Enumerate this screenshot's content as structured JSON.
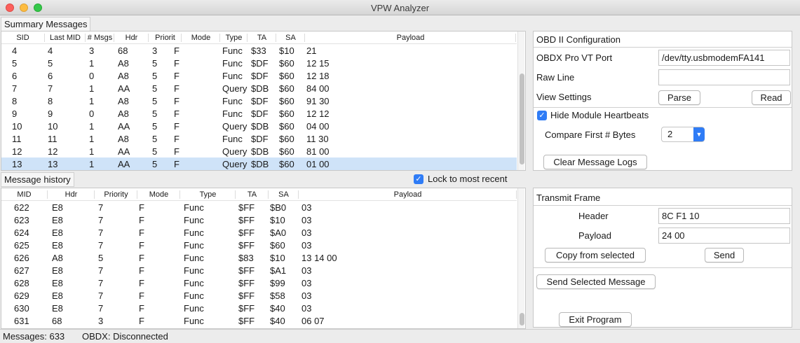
{
  "window": {
    "title": "VPW Analyzer"
  },
  "summary": {
    "tab_label": "Summary Messages",
    "columns": [
      "SID",
      "Last MID",
      "# Msgs",
      "Hdr",
      "Priorit",
      "Mode",
      "Type",
      "TA",
      "SA",
      "Payload"
    ],
    "rows": [
      [
        "4",
        "4",
        "3",
        "68",
        "3",
        "F",
        "Func",
        "$33",
        "$10",
        "21"
      ],
      [
        "5",
        "5",
        "1",
        "A8",
        "5",
        "F",
        "Func",
        "$DF",
        "$60",
        "12 15"
      ],
      [
        "6",
        "6",
        "0",
        "A8",
        "5",
        "F",
        "Func",
        "$DF",
        "$60",
        "12 18"
      ],
      [
        "7",
        "7",
        "1",
        "AA",
        "5",
        "F",
        "Query",
        "$DB",
        "$60",
        "84 00"
      ],
      [
        "8",
        "8",
        "1",
        "A8",
        "5",
        "F",
        "Func",
        "$DF",
        "$60",
        "91 30"
      ],
      [
        "9",
        "9",
        "0",
        "A8",
        "5",
        "F",
        "Func",
        "$DF",
        "$60",
        "12 12"
      ],
      [
        "10",
        "10",
        "1",
        "AA",
        "5",
        "F",
        "Query",
        "$DB",
        "$60",
        "04 00"
      ],
      [
        "11",
        "11",
        "1",
        "A8",
        "5",
        "F",
        "Func",
        "$DF",
        "$60",
        "11 30"
      ],
      [
        "12",
        "12",
        "1",
        "AA",
        "5",
        "F",
        "Query",
        "$DB",
        "$60",
        "81 00"
      ],
      [
        "13",
        "13",
        "1",
        "AA",
        "5",
        "F",
        "Query",
        "$DB",
        "$60",
        "01 00"
      ]
    ],
    "selected_row": 9
  },
  "history": {
    "tab_label": "Message history",
    "lock_label": "Lock to most recent",
    "lock_checked": true,
    "columns": [
      "MID",
      "Hdr",
      "Priority",
      "Mode",
      "Type",
      "TA",
      "SA",
      "Payload"
    ],
    "rows": [
      [
        "622",
        "E8",
        "7",
        "F",
        "Func",
        "$FF",
        "$B0",
        "03"
      ],
      [
        "623",
        "E8",
        "7",
        "F",
        "Func",
        "$FF",
        "$10",
        "03"
      ],
      [
        "624",
        "E8",
        "7",
        "F",
        "Func",
        "$FF",
        "$A0",
        "03"
      ],
      [
        "625",
        "E8",
        "7",
        "F",
        "Func",
        "$FF",
        "$60",
        "03"
      ],
      [
        "626",
        "A8",
        "5",
        "F",
        "Func",
        "$83",
        "$10",
        "13 14 00"
      ],
      [
        "627",
        "E8",
        "7",
        "F",
        "Func",
        "$FF",
        "$A1",
        "03"
      ],
      [
        "628",
        "E8",
        "7",
        "F",
        "Func",
        "$FF",
        "$99",
        "03"
      ],
      [
        "629",
        "E8",
        "7",
        "F",
        "Func",
        "$FF",
        "$58",
        "03"
      ],
      [
        "630",
        "E8",
        "7",
        "F",
        "Func",
        "$FF",
        "$40",
        "03"
      ],
      [
        "631",
        "68",
        "3",
        "F",
        "Func",
        "$FF",
        "$40",
        "06 07"
      ]
    ]
  },
  "obd": {
    "title": "OBD II Configuration",
    "port_label": "OBDX Pro VT Port",
    "port_value": "/dev/tty.usbmodemFA141",
    "raw_label": "Raw Line",
    "raw_value": "",
    "view_label": "View Settings",
    "parse_label": "Parse",
    "read_label": "Read",
    "hide_label": "Hide Module Heartbeats",
    "hide_checked": true,
    "compare_label": "Compare First # Bytes",
    "compare_value": "2",
    "clear_label": "Clear Message Logs"
  },
  "transmit": {
    "title": "Transmit Frame",
    "header_label": "Header",
    "header_value": "8C F1 10",
    "payload_label": "Payload",
    "payload_value": "24 00",
    "copy_label": "Copy from selected",
    "send_label": "Send",
    "send_selected_label": "Send Selected Message",
    "exit_label": "Exit Program"
  },
  "status": {
    "messages": "Messages: 633",
    "obdx": "OBDX: Disconnected"
  },
  "colors": {
    "accent": "#2f7cf6",
    "selection": "#cfe3f8",
    "close": "#fc605c",
    "minimize": "#fdbc40",
    "zoom": "#34c84a"
  }
}
